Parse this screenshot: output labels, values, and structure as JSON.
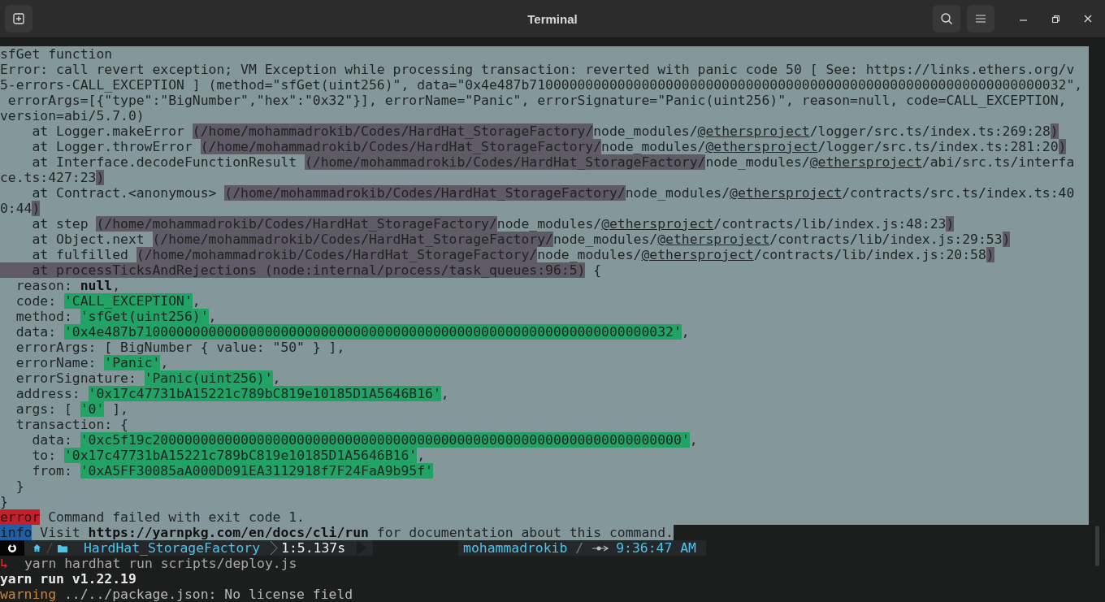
{
  "window": {
    "title": "Terminal"
  },
  "lines": [
    {
      "selected": true,
      "segments": [
        {
          "kind": "plain",
          "text": "sfGet function"
        }
      ]
    },
    {
      "selected": true,
      "segments": [
        {
          "kind": "plain",
          "text": "Error: call revert exception; VM Exception while processing transaction: reverted with panic code 50 [ See: https://links.ethers.org/v"
        }
      ]
    },
    {
      "selected": true,
      "segments": [
        {
          "kind": "plain",
          "text": "5-errors-CALL_EXCEPTION ] (method=\"sfGet(uint256)\", data=\"0x4e487b7100000000000000000000000000000000000000000000000000000000000000032\","
        }
      ]
    },
    {
      "selected": true,
      "segments": [
        {
          "kind": "plain",
          "text": " errorArgs=[{\"type\":\"BigNumber\",\"hex\":\"0x32\"}], errorName=\"Panic\", errorSignature=\"Panic(uint256)\", reason=null, code=CALL_EXCEPTION,"
        }
      ]
    },
    {
      "selected": true,
      "segments": [
        {
          "kind": "plain",
          "text": "version=abi/5.7.0)"
        }
      ]
    },
    {
      "selected": true,
      "segments": [
        {
          "kind": "plain",
          "text": "    at Logger.makeError "
        },
        {
          "kind": "path",
          "text": "(/home/mohammadrokib/Codes/HardHat_StorageFactory/"
        },
        {
          "kind": "plain",
          "text": "node_modules/"
        },
        {
          "kind": "link",
          "text": "@ethersproject"
        },
        {
          "kind": "plain",
          "text": "/logger/src.ts/index.ts:269:28"
        },
        {
          "kind": "path",
          "text": ")"
        }
      ]
    },
    {
      "selected": true,
      "segments": [
        {
          "kind": "plain",
          "text": "    at Logger.throwError "
        },
        {
          "kind": "path",
          "text": "(/home/mohammadrokib/Codes/HardHat_StorageFactory/"
        },
        {
          "kind": "plain",
          "text": "node_modules/"
        },
        {
          "kind": "link",
          "text": "@ethersproject"
        },
        {
          "kind": "plain",
          "text": "/logger/src.ts/index.ts:281:20"
        },
        {
          "kind": "path",
          "text": ")"
        }
      ]
    },
    {
      "selected": true,
      "segments": [
        {
          "kind": "plain",
          "text": "    at Interface.decodeFunctionResult "
        },
        {
          "kind": "path",
          "text": "(/home/mohammadrokib/Codes/HardHat_StorageFactory/"
        },
        {
          "kind": "plain",
          "text": "node_modules/"
        },
        {
          "kind": "link",
          "text": "@ethersproject"
        },
        {
          "kind": "plain",
          "text": "/abi/src.ts/interfa"
        }
      ]
    },
    {
      "selected": true,
      "segments": [
        {
          "kind": "plain",
          "text": "ce.ts:427:23"
        },
        {
          "kind": "path",
          "text": ")"
        }
      ]
    },
    {
      "selected": true,
      "segments": [
        {
          "kind": "plain",
          "text": "    at Contract.<anonymous> "
        },
        {
          "kind": "path",
          "text": "(/home/mohammadrokib/Codes/HardHat_StorageFactory/"
        },
        {
          "kind": "plain",
          "text": "node_modules/"
        },
        {
          "kind": "link",
          "text": "@ethersproject"
        },
        {
          "kind": "plain",
          "text": "/contracts/src.ts/index.ts:40"
        }
      ]
    },
    {
      "selected": true,
      "segments": [
        {
          "kind": "plain",
          "text": "0:44"
        },
        {
          "kind": "path",
          "text": ")"
        }
      ]
    },
    {
      "selected": true,
      "segments": [
        {
          "kind": "plain",
          "text": "    at step "
        },
        {
          "kind": "path",
          "text": "(/home/mohammadrokib/Codes/HardHat_StorageFactory/"
        },
        {
          "kind": "plain",
          "text": "node_modules/"
        },
        {
          "kind": "link",
          "text": "@ethersproject"
        },
        {
          "kind": "plain",
          "text": "/contracts/lib/index.js:48:23"
        },
        {
          "kind": "path",
          "text": ")"
        }
      ]
    },
    {
      "selected": true,
      "segments": [
        {
          "kind": "plain",
          "text": "    at Object.next "
        },
        {
          "kind": "path",
          "text": "(/home/mohammadrokib/Codes/HardHat_StorageFactory/"
        },
        {
          "kind": "plain",
          "text": "node_modules/"
        },
        {
          "kind": "link",
          "text": "@ethersproject"
        },
        {
          "kind": "plain",
          "text": "/contracts/lib/index.js:29:53"
        },
        {
          "kind": "path",
          "text": ")"
        }
      ]
    },
    {
      "selected": true,
      "segments": [
        {
          "kind": "plain",
          "text": "    at fulfilled "
        },
        {
          "kind": "path",
          "text": "(/home/mohammadrokib/Codes/HardHat_StorageFactory/"
        },
        {
          "kind": "plain",
          "text": "node_modules/"
        },
        {
          "kind": "link",
          "text": "@ethersproject"
        },
        {
          "kind": "plain",
          "text": "/contracts/lib/index.js:20:58"
        },
        {
          "kind": "path",
          "text": ")"
        }
      ]
    },
    {
      "selected": true,
      "segments": [
        {
          "kind": "path",
          "text": "    at processTicksAndRejections (node:internal/process/task_queues:96:5)"
        },
        {
          "kind": "plain",
          "text": " {"
        }
      ]
    },
    {
      "selected": true,
      "segments": [
        {
          "kind": "plain",
          "text": "  reason: "
        },
        {
          "kind": "bold",
          "text": "null"
        },
        {
          "kind": "plain",
          "text": ","
        }
      ]
    },
    {
      "selected": true,
      "segments": [
        {
          "kind": "plain",
          "text": "  code: "
        },
        {
          "kind": "string",
          "text": "'CALL_EXCEPTION'"
        },
        {
          "kind": "plain",
          "text": ","
        }
      ]
    },
    {
      "selected": true,
      "segments": [
        {
          "kind": "plain",
          "text": "  method: "
        },
        {
          "kind": "string",
          "text": "'sfGet(uint256)'"
        },
        {
          "kind": "plain",
          "text": ","
        }
      ]
    },
    {
      "selected": true,
      "segments": [
        {
          "kind": "plain",
          "text": "  data: "
        },
        {
          "kind": "string",
          "text": "'0x4e487b7100000000000000000000000000000000000000000000000000000000000000032'"
        },
        {
          "kind": "plain",
          "text": ","
        }
      ]
    },
    {
      "selected": true,
      "segments": [
        {
          "kind": "plain",
          "text": "  errorArgs: [ BigNumber { value: \"50\" } ],"
        }
      ]
    },
    {
      "selected": true,
      "segments": [
        {
          "kind": "plain",
          "text": "  errorName: "
        },
        {
          "kind": "string",
          "text": "'Panic'"
        },
        {
          "kind": "plain",
          "text": ","
        }
      ]
    },
    {
      "selected": true,
      "segments": [
        {
          "kind": "plain",
          "text": "  errorSignature: "
        },
        {
          "kind": "string",
          "text": "'Panic(uint256)'"
        },
        {
          "kind": "plain",
          "text": ","
        }
      ]
    },
    {
      "selected": true,
      "segments": [
        {
          "kind": "plain",
          "text": "  address: "
        },
        {
          "kind": "string",
          "text": "'0x17c47731bA15221c789bC819e10185D1A5646B16'"
        },
        {
          "kind": "plain",
          "text": ","
        }
      ]
    },
    {
      "selected": true,
      "segments": [
        {
          "kind": "plain",
          "text": "  args: [ "
        },
        {
          "kind": "string",
          "text": "'0'"
        },
        {
          "kind": "plain",
          "text": " ],"
        }
      ]
    },
    {
      "selected": true,
      "segments": [
        {
          "kind": "plain",
          "text": "  transaction: {"
        }
      ]
    },
    {
      "selected": true,
      "segments": [
        {
          "kind": "plain",
          "text": "    data: "
        },
        {
          "kind": "string",
          "text": "'0xc5f19c200000000000000000000000000000000000000000000000000000000000000000'"
        },
        {
          "kind": "plain",
          "text": ","
        }
      ]
    },
    {
      "selected": true,
      "segments": [
        {
          "kind": "plain",
          "text": "    to: "
        },
        {
          "kind": "string",
          "text": "'0x17c47731bA15221c789bC819e10185D1A5646B16'"
        },
        {
          "kind": "plain",
          "text": ","
        }
      ]
    },
    {
      "selected": true,
      "segments": [
        {
          "kind": "plain",
          "text": "    from: "
        },
        {
          "kind": "string",
          "text": "'0xA5FF30085aA000D091EA3112918f7F24FaA9b95f'"
        }
      ]
    },
    {
      "selected": true,
      "segments": [
        {
          "kind": "plain",
          "text": "  }"
        }
      ]
    },
    {
      "selected": true,
      "segments": [
        {
          "kind": "plain",
          "text": "}"
        }
      ]
    },
    {
      "selected": true,
      "segments": [
        {
          "kind": "error",
          "text": "error"
        },
        {
          "kind": "plain",
          "text": " Command failed with exit code 1."
        }
      ]
    },
    {
      "selected": true,
      "segments": [
        {
          "kind": "info",
          "text": "info"
        },
        {
          "kind": "plain",
          "text": " Visit "
        },
        {
          "kind": "bold",
          "text": "https://yarnpkg.com/en/docs/cli/run"
        },
        {
          "kind": "plain",
          "text": " for documentation about this command."
        }
      ]
    }
  ],
  "prompt": {
    "directory": "HardHat_StorageFactory",
    "duration": "1:5.137s",
    "user": "mohammadrokib",
    "separator": "/",
    "time": "9:36:47 AM"
  },
  "command": {
    "arrow": "↳",
    "text": "yarn hardhat run scripts/deploy.js"
  },
  "output": [
    {
      "segments": [
        {
          "kind": "bold",
          "text": "yarn run v1.22.19"
        }
      ]
    },
    {
      "segments": [
        {
          "kind": "warning",
          "text": "warning"
        },
        {
          "kind": "plain",
          "text": " ../../package.json: No license field"
        }
      ]
    }
  ]
}
